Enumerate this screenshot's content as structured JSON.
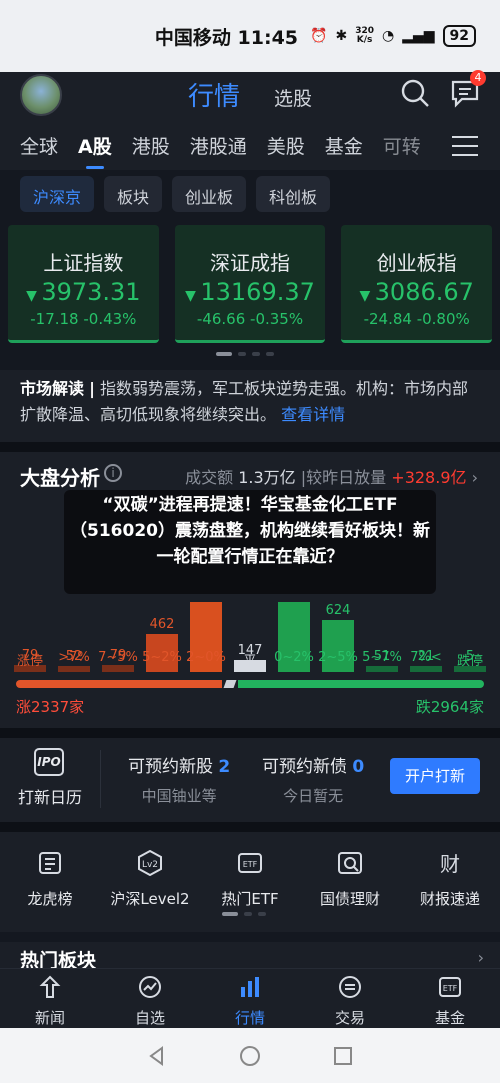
{
  "status": {
    "carrier": "中国移动",
    "time": "11:45",
    "net_speed_top": "320",
    "net_speed_bottom": "K/s",
    "battery": "92"
  },
  "header": {
    "title": "行情",
    "subtitle": "选股",
    "message_badge": "4"
  },
  "tabs": [
    "全球",
    "A股",
    "港股",
    "港股通",
    "美股",
    "基金",
    "可转"
  ],
  "subtabs": [
    "沪深京",
    "板块",
    "创业板",
    "科创板"
  ],
  "indices": [
    {
      "name": "上证指数",
      "value": "3973.31",
      "change": "-17.18 -0.43%"
    },
    {
      "name": "深证成指",
      "value": "13169.37",
      "change": "-46.66 -0.35%"
    },
    {
      "name": "创业板指",
      "value": "3086.67",
      "change": "-24.84 -0.80%"
    }
  ],
  "market_note": {
    "label": "市场解读",
    "sep": "|",
    "text": "指数弱势震荡，军工板块逆势走强。机构：市场内部扩散降温、高切低现象将继续突出。",
    "link": "查看详情"
  },
  "overview": {
    "title": "大盘分析",
    "info_icon": "i",
    "turnover_label": "成交额",
    "turnover": "1.3万亿",
    "compare_label": "|较昨日放量",
    "compare": "+328.9亿",
    "up_count": "涨2337家",
    "down_count": "跌2964家"
  },
  "chart_data": {
    "type": "bar",
    "categories": [
      "涨停",
      ">7%",
      "7~5%",
      "5~2%",
      "2~0%",
      "平",
      "0~2%",
      "2~5%",
      "5~7%",
      "7%<",
      "跌停"
    ],
    "values": [
      79,
      52,
      79,
      462,
      1800,
      147,
      1800,
      624,
      51,
      21,
      5
    ],
    "value_labels": [
      "79",
      "52",
      "79",
      "462",
      "",
      "147",
      "",
      "624",
      "51",
      "21",
      "5"
    ],
    "colors": [
      "#7a2f1a",
      "#7a2f1a",
      "#7a2f1a",
      "#c8461f",
      "#d9501f",
      "#d7dbe2",
      "#1fa04f",
      "#1fa04f",
      "#166b3a",
      "#166b3a",
      "#166b3a"
    ],
    "label_colors": [
      "#e2552a",
      "#e2552a",
      "#e2552a",
      "#e2552a",
      "#e2552a",
      "#d7dbe2",
      "#27c26a",
      "#27c26a",
      "#27c26a",
      "#27c26a",
      "#27c26a"
    ],
    "up_ratio": 0.44
  },
  "overlay_text": "“双碳”进程再提速！华宝基金化工ETF（516020）震荡盘整，机构继续看好板块！新一轮配置行情正在靠近？",
  "ipo": {
    "icon_text": "IPO",
    "label": "打新日历",
    "stock_title": "可预约新股",
    "stock_count": "2",
    "stock_sub": "中国铀业等",
    "bond_title": "可预约新债",
    "bond_count": "0",
    "bond_sub": "今日暂无",
    "button": "开户打新"
  },
  "tools": [
    {
      "label": "龙虎榜",
      "icon": "list-icon"
    },
    {
      "label": "沪深Level2",
      "icon": "level2-icon"
    },
    {
      "label": "热门ETF",
      "icon": "etf-icon"
    },
    {
      "label": "国债理财",
      "icon": "bond-icon"
    },
    {
      "label": "财报速递",
      "icon": "report-icon"
    }
  ],
  "tool_glyphs": {
    "lv2": "Lv2",
    "etf": "ETF",
    "report": "财"
  },
  "hot": {
    "title": "热门板块"
  },
  "bottom_nav": [
    {
      "label": "新闻",
      "icon": "news-icon"
    },
    {
      "label": "自选",
      "icon": "watchlist-icon"
    },
    {
      "label": "行情",
      "icon": "market-icon"
    },
    {
      "label": "交易",
      "icon": "trade-icon"
    },
    {
      "label": "基金",
      "icon": "fund-icon"
    }
  ],
  "nav_glyphs": {
    "fund": "ETF"
  },
  "accent": "#3d8bff"
}
